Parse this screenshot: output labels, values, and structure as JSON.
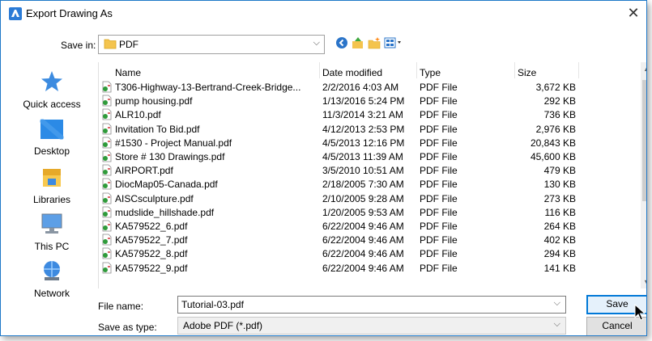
{
  "window": {
    "title": "Export Drawing As",
    "close_glyph": "✕"
  },
  "save_in": {
    "label": "Save in:",
    "value": "PDF",
    "chevron": "⌵"
  },
  "places": [
    {
      "label": "Quick access",
      "icon": "star-icon"
    },
    {
      "label": "Desktop",
      "icon": "desktop-icon"
    },
    {
      "label": "Libraries",
      "icon": "libraries-icon"
    },
    {
      "label": "This PC",
      "icon": "computer-icon"
    },
    {
      "label": "Network",
      "icon": "network-icon"
    }
  ],
  "columns": {
    "name": "Name",
    "date": "Date modified",
    "type": "Type",
    "size": "Size"
  },
  "files": [
    {
      "name": "T306-Highway-13-Bertrand-Creek-Bridge...",
      "date": "2/2/2016 4:03 AM",
      "type": "PDF File",
      "size": "3,672 KB"
    },
    {
      "name": "pump housing.pdf",
      "date": "1/13/2016 5:24 PM",
      "type": "PDF File",
      "size": "292 KB"
    },
    {
      "name": "ALR10.pdf",
      "date": "11/3/2014 3:21 AM",
      "type": "PDF File",
      "size": "736 KB"
    },
    {
      "name": "Invitation To Bid.pdf",
      "date": "4/12/2013 2:53 PM",
      "type": "PDF File",
      "size": "2,976 KB"
    },
    {
      "name": "#1530 - Project Manual.pdf",
      "date": "4/5/2013 12:16 PM",
      "type": "PDF File",
      "size": "20,843 KB"
    },
    {
      "name": "Store # 130 Drawings.pdf",
      "date": "4/5/2013 11:39 AM",
      "type": "PDF File",
      "size": "45,600 KB"
    },
    {
      "name": "AIRPORT.pdf",
      "date": "3/5/2010 10:51 AM",
      "type": "PDF File",
      "size": "479 KB"
    },
    {
      "name": "DiocMap05-Canada.pdf",
      "date": "2/18/2005 7:30 AM",
      "type": "PDF File",
      "size": "130 KB"
    },
    {
      "name": "AISCsculpture.pdf",
      "date": "2/10/2005 9:28 AM",
      "type": "PDF File",
      "size": "273 KB"
    },
    {
      "name": "mudslide_hillshade.pdf",
      "date": "1/20/2005 9:53 AM",
      "type": "PDF File",
      "size": "116 KB"
    },
    {
      "name": "KA579522_6.pdf",
      "date": "6/22/2004 9:46 AM",
      "type": "PDF File",
      "size": "264 KB"
    },
    {
      "name": "KA579522_7.pdf",
      "date": "6/22/2004 9:46 AM",
      "type": "PDF File",
      "size": "402 KB"
    },
    {
      "name": "KA579522_8.pdf",
      "date": "6/22/2004 9:46 AM",
      "type": "PDF File",
      "size": "294 KB"
    },
    {
      "name": "KA579522_9.pdf",
      "date": "6/22/2004 9:46 AM",
      "type": "PDF File",
      "size": "141 KB"
    }
  ],
  "file_name": {
    "label": "File name:",
    "value": "Tutorial-03.pdf"
  },
  "save_as_type": {
    "label": "Save as type:",
    "value": "Adobe PDF (*.pdf)"
  },
  "buttons": {
    "save": "Save",
    "cancel": "Cancel"
  },
  "colors": {
    "accent": "#0078d7",
    "title_border": "#1e78c8"
  }
}
